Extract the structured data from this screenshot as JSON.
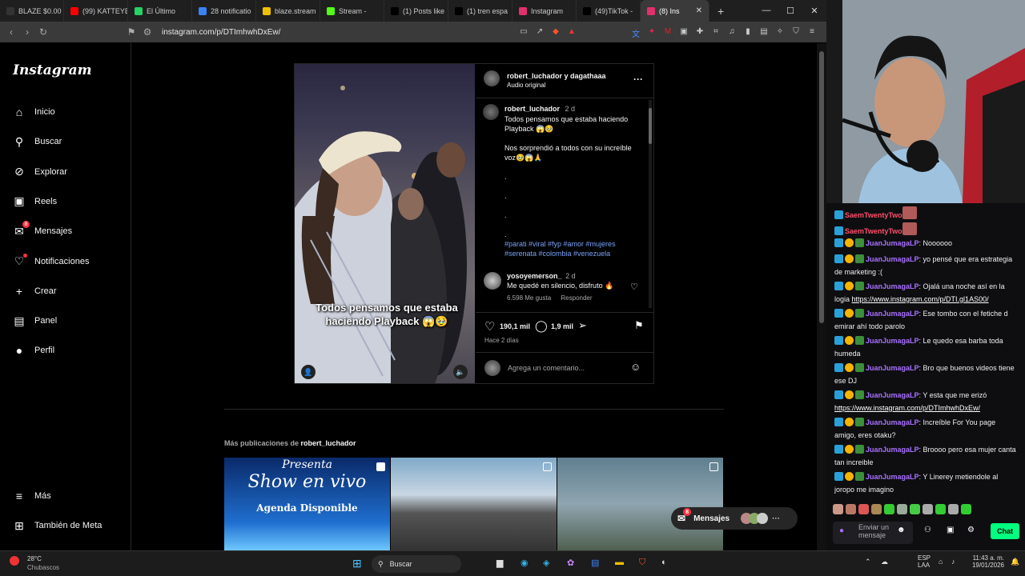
{
  "browser": {
    "tabs": [
      {
        "label": "BLAZE $0.00",
        "color": "#333"
      },
      {
        "label": "(99) KATTEYE",
        "color": "#ff0000"
      },
      {
        "label": "El Último",
        "color": "#25d366"
      },
      {
        "label": "28 notificatio",
        "color": "#3b82f6"
      },
      {
        "label": "blaze.stream",
        "color": "#f0c000"
      },
      {
        "label": "Stream -",
        "color": "#53fc18"
      },
      {
        "label": "(1) Posts like",
        "color": "#000"
      },
      {
        "label": "(1) tren espa",
        "color": "#000"
      },
      {
        "label": "Instagram",
        "color": "#e1306c"
      },
      {
        "label": "(49)TikTok -",
        "color": "#000"
      },
      {
        "label": "(8) Ins",
        "color": "#e1306c"
      }
    ],
    "url": "instagram.com/p/DTImhwhDxEw/",
    "new_tab": "+"
  },
  "sidebar": {
    "logo": "Instagram",
    "items": [
      {
        "label": "Inicio",
        "icon": "home-icon",
        "glyph": "⌂"
      },
      {
        "label": "Buscar",
        "icon": "search-icon",
        "glyph": "⚲"
      },
      {
        "label": "Explorar",
        "icon": "compass-icon",
        "glyph": "⊘"
      },
      {
        "label": "Reels",
        "icon": "reels-icon",
        "glyph": "▣"
      },
      {
        "label": "Mensajes",
        "icon": "messenger-icon",
        "glyph": "✉",
        "badge": "8"
      },
      {
        "label": "Notificaciones",
        "icon": "heart-icon",
        "glyph": "♡"
      },
      {
        "label": "Crear",
        "icon": "plus-icon",
        "glyph": "+"
      },
      {
        "label": "Panel",
        "icon": "dashboard-icon",
        "glyph": "▤"
      },
      {
        "label": "Perfil",
        "icon": "profile-avatar-icon",
        "glyph": "●"
      }
    ],
    "more": "Más",
    "meta": "También de Meta"
  },
  "post": {
    "header_users": "robert_luchador y dagathaaa",
    "audio": "Audio original",
    "video_caption": "Todos pensamos que estaba haciendo Playback 😱🥹",
    "caption_user": "robert_luchador",
    "caption_time": "2 d",
    "caption_line1": "Todos pensamos que estaba haciendo Playback 😱🥹",
    "caption_line2": "Nos sorprendió a todos con su increíble voz🥹😱🙏",
    "dots": ".",
    "hashtags_1": "#parati #viral #fyp #amor #mujeres",
    "hashtags_2": "#serenata #colombia #venezuela",
    "comment_user": "yosoyemerson_",
    "comment_time": "2 d",
    "comment_text": "Me quedé en silencio, disfruto 🔥",
    "comment_likes": "6.598 Me gusta",
    "comment_reply": "Responder",
    "likes": "190,1 mil",
    "comments": "1,9 mil",
    "posted": "Hace 2 días",
    "comment_placeholder": "Agrega un comentario..."
  },
  "more_posts": {
    "prefix": "Más publicaciones de ",
    "user": "robert_luchador",
    "thumb1_line1": "Presenta",
    "thumb1_line2": "Show en vivo",
    "thumb1_line3": "Agenda Disponible"
  },
  "messages_pill": {
    "label": "Mensajes",
    "badge": "8"
  },
  "chat": {
    "lines": [
      {
        "user": "SaemTwentyTwo",
        "text": ""
      },
      {
        "user": "SaemTwentyTwo",
        "text": ""
      },
      {
        "user": "JuanJumagaLP",
        "text": ": Noooooo"
      },
      {
        "user": "JuanJumagaLP",
        "text": ": yo pensé que era estrategia de marketing :("
      },
      {
        "user": "JuanJumagaLP",
        "text": ": Ojalá una noche así en la logia ",
        "link": "https://www.instagram.com/p/DTI.gl1AS00/"
      },
      {
        "user": "JuanJumagaLP",
        "text": ": Ese tombo con el fetiche d emirar ahí todo parolo"
      },
      {
        "user": "JuanJumagaLP",
        "text": ": Le quedo esa barba toda humeda"
      },
      {
        "user": "JuanJumagaLP",
        "text": ": Bro que buenos videos tiene ese DJ"
      },
      {
        "user": "JuanJumagaLP",
        "text": ": Y esta que me erizó ",
        "link": "https://www.instagram.com/p/DTImhwhDxEw/"
      },
      {
        "user": "JuanJumagaLP",
        "text": ": Increíble For You page amigo, eres otaku?"
      },
      {
        "user": "JuanJumagaLP",
        "text": ": Broooo pero esa mujer canta tan increible"
      },
      {
        "user": "JuanJumagaLP",
        "text": ": Y Linerey metiendole al joropo me imagino"
      }
    ],
    "input_placeholder": "Enviar un mensaje",
    "chat_button": "Chat"
  },
  "taskbar": {
    "weather_temp": "28°C",
    "weather_desc": "Chubascos",
    "search": "Buscar",
    "lang1": "ESP",
    "lang2": "LAA",
    "time": "11:43 a. m.",
    "date": "19/01/2026"
  }
}
